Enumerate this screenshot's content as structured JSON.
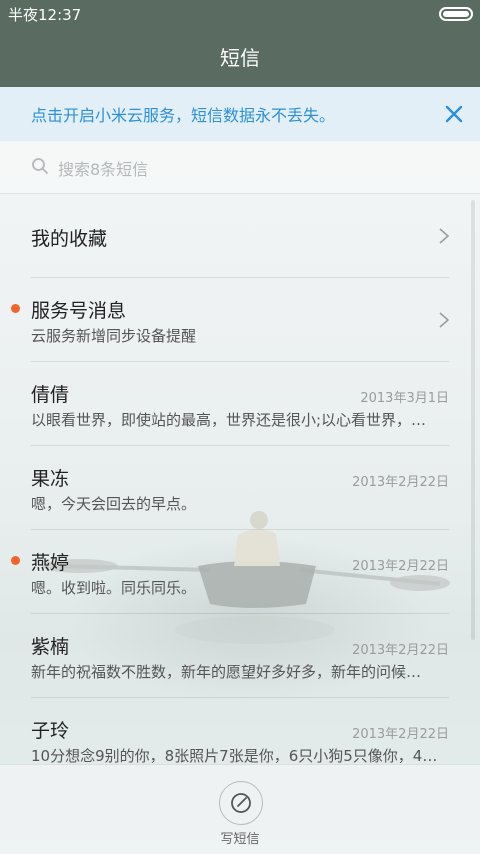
{
  "status_bar": {
    "time": "半夜12:37"
  },
  "title": "短信",
  "banner": {
    "text": "点击开启小米云服务，短信数据永不丢失。"
  },
  "search": {
    "placeholder": "搜索8条短信"
  },
  "conversations": [
    {
      "name": "我的收藏",
      "preview": "",
      "date": "",
      "unread": false,
      "chevron": true
    },
    {
      "name": "服务号消息",
      "preview": "云服务新增同步设备提醒",
      "date": "",
      "unread": true,
      "chevron": true
    },
    {
      "name": "倩倩",
      "preview": "以眼看世界，即使站的最高，世界还是很小;以心看世界，…",
      "date": "2013年3月1日",
      "unread": false,
      "chevron": false
    },
    {
      "name": "果冻",
      "preview": "嗯，今天会回去的早点。",
      "date": "2013年2月22日",
      "unread": false,
      "chevron": false
    },
    {
      "name": "燕婷",
      "preview": "嗯。收到啦。同乐同乐。",
      "date": "2013年2月22日",
      "unread": true,
      "chevron": false
    },
    {
      "name": "紫楠",
      "preview": "新年的祝福数不胜数，新年的愿望好多好多，新年的问候…",
      "date": "2013年2月22日",
      "unread": false,
      "chevron": false
    },
    {
      "name": "子玲",
      "preview": "10分想念9别的你，8张照片7张是你，6只小狗5只像你，4…",
      "date": "2013年2月22日",
      "unread": false,
      "chevron": false
    }
  ],
  "bottom": {
    "compose_label": "写短信"
  },
  "colors": {
    "header": "#5a6b62",
    "accent": "#2c90d8",
    "unread_dot": "#f2642a"
  }
}
